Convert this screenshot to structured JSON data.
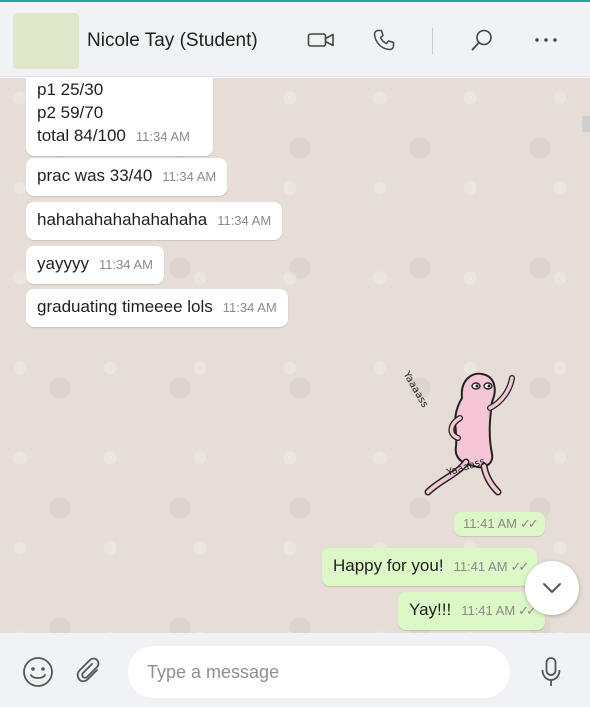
{
  "header": {
    "contact_name": "Nicole Tay (Student)",
    "icons": [
      "video-call-icon",
      "voice-call-icon",
      "search-icon",
      "more-options-icon"
    ]
  },
  "messages": [
    {
      "direction": "in",
      "lines": [
        "p1 25/30",
        "p2 59/70",
        "total 84/100"
      ],
      "time": "11:34 AM"
    },
    {
      "direction": "in",
      "text": "prac was 33/40",
      "time": "11:34 AM"
    },
    {
      "direction": "in",
      "text": "hahahahahahahahaha",
      "time": "11:34 AM"
    },
    {
      "direction": "in",
      "text": "yayyyy",
      "time": "11:34 AM"
    },
    {
      "direction": "in",
      "text": "graduating timeeee lols",
      "time": "11:34 AM"
    },
    {
      "direction": "out",
      "type": "sticker",
      "sticker_text": "Yaaaass",
      "time": "11:41 AM",
      "ticks": "✓✓"
    },
    {
      "direction": "out",
      "text": "Happy for you!",
      "time": "11:41 AM",
      "ticks": "✓✓"
    },
    {
      "direction": "out",
      "text": "Yay!!!",
      "time": "11:41 AM",
      "ticks": "✓✓"
    }
  ],
  "composer": {
    "placeholder": "Type a message",
    "value": ""
  },
  "colors": {
    "chat_background": "#e6ded6",
    "outgoing_bubble": "#dcf8c6",
    "incoming_bubble": "#ffffff",
    "header_background": "#f0f2f5",
    "accent": "#1fa89b"
  }
}
